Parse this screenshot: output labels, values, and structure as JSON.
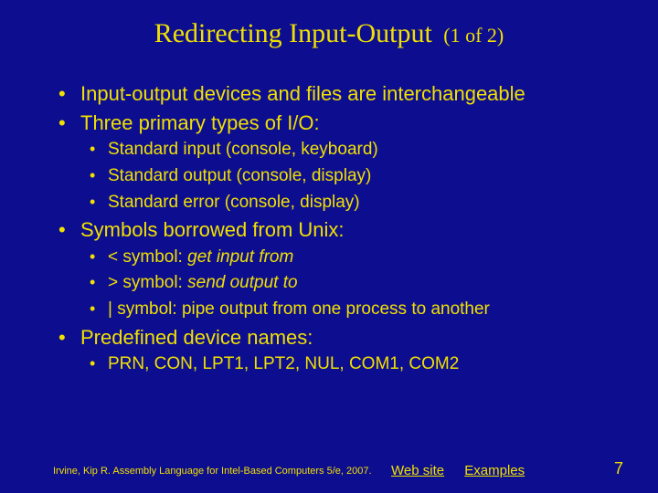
{
  "title": "Redirecting Input-Output",
  "title_suffix": "(1 of 2)",
  "bullets": [
    {
      "level": 1,
      "text": "Input-output devices and files are interchangeable"
    },
    {
      "level": 1,
      "text": "Three primary types of I/O:"
    },
    {
      "level": 2,
      "text": "Standard input (console, keyboard)"
    },
    {
      "level": 2,
      "text": "Standard output (console, display)"
    },
    {
      "level": 2,
      "text": "Standard error (console, display)"
    },
    {
      "level": 1,
      "text": "Symbols borrowed from Unix:"
    },
    {
      "level": 2,
      "prefix": "< symbol: ",
      "em": "get input from"
    },
    {
      "level": 2,
      "prefix": "> symbol: ",
      "em": "send output to"
    },
    {
      "level": 2,
      "text": "| symbol: pipe output from one process to another"
    },
    {
      "level": 1,
      "text": "Predefined device names:"
    },
    {
      "level": 2,
      "text": "PRN, CON, LPT1, LPT2, NUL, COM1, COM2"
    }
  ],
  "footer": {
    "citation": "Irvine, Kip R. Assembly Language for Intel-Based Computers 5/e, 2007.",
    "link1": "Web site",
    "link2": "Examples"
  },
  "page_number": "7"
}
